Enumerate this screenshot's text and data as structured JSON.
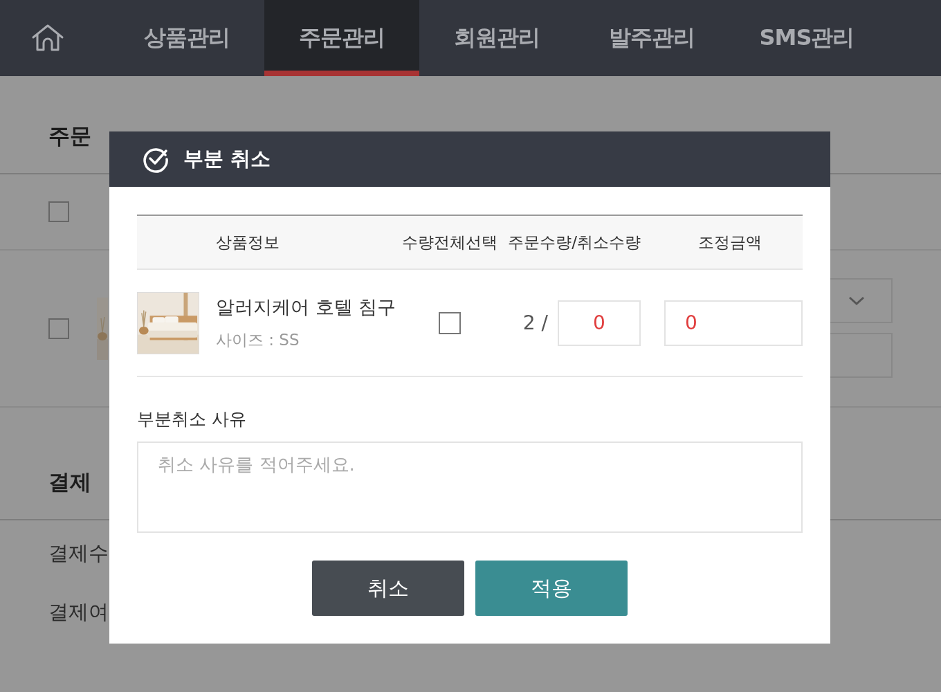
{
  "nav": {
    "items": [
      {
        "label": "상품관리",
        "selected": false
      },
      {
        "label": "주문관리",
        "selected": true
      },
      {
        "label": "회원관리",
        "selected": false
      },
      {
        "label": "발주관리",
        "selected": false
      },
      {
        "label": "SMS관리",
        "selected": false
      }
    ]
  },
  "background": {
    "order_title": "주문",
    "row_1": {
      "checked": false
    },
    "row_2": {
      "checked": false
    },
    "payment_title": "결제",
    "payment_rows": [
      "결제수",
      "결제여"
    ]
  },
  "dialog": {
    "title": "부분 취소",
    "columns": [
      "상품정보",
      "수량전체선택",
      "주문수량/취소수량",
      "조정금액"
    ],
    "rows": [
      {
        "name": "알러지케어 호텔 침구",
        "option": "사이즈 : SS",
        "select_all": false,
        "order_qty": "2 /",
        "cancel_qty": "0",
        "amount": "0"
      }
    ],
    "reason_label": "부분취소 사유",
    "reason": {
      "placeholder": "취소 사유를 적어주세요."
    },
    "buttons": [
      {
        "label": "취소",
        "kind": "secondary"
      },
      {
        "label": "적용",
        "kind": "primary"
      }
    ]
  }
}
